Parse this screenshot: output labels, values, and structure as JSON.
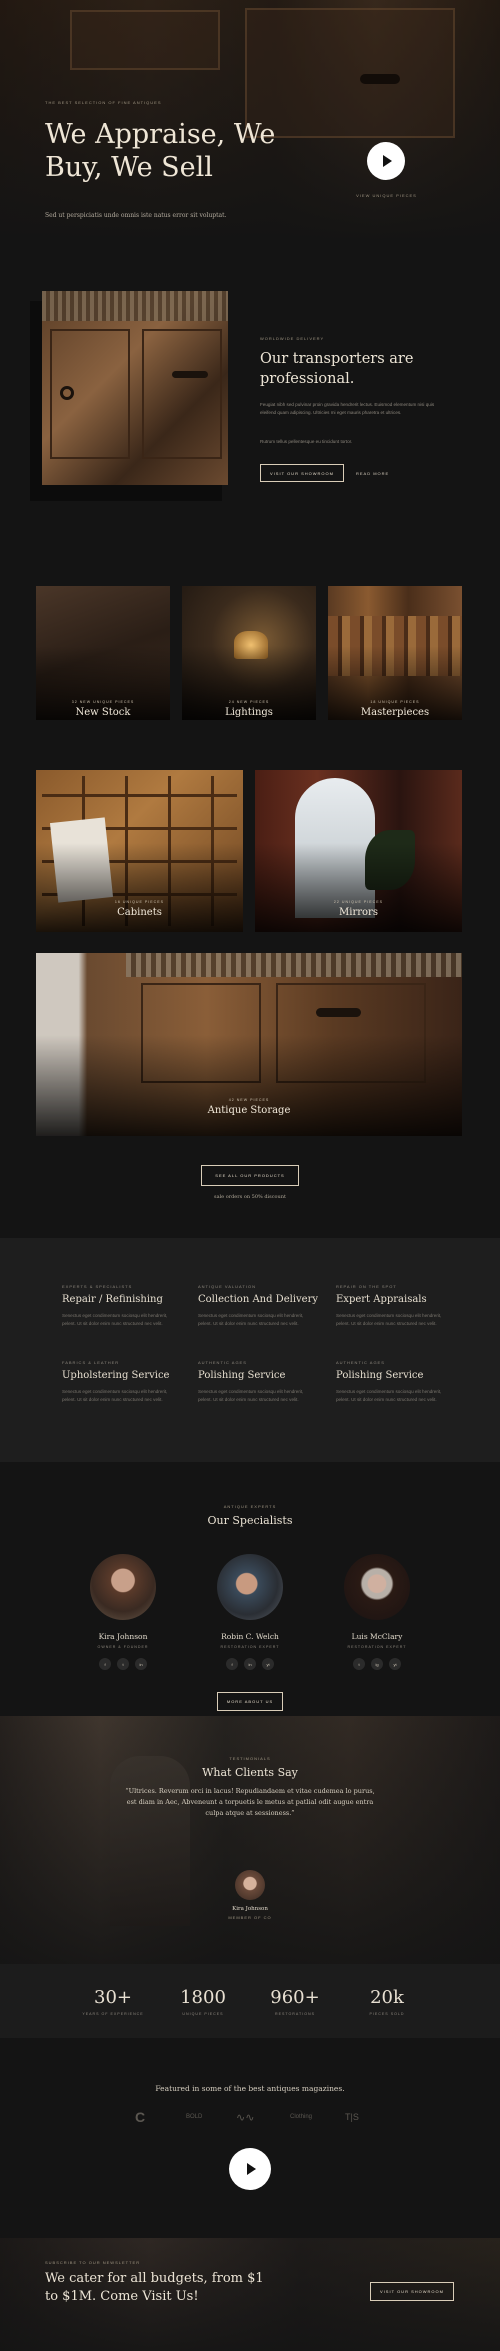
{
  "hero": {
    "eyebrow": "The best selection of fine antiques",
    "title": "We Appraise, We Buy, We Sell",
    "subtitle": "Sed ut perspiciatis unde omnis iste natus error sit voluptat.",
    "play_caption": "View unique pieces"
  },
  "transport": {
    "eyebrow": "Worldwide delivery",
    "title": "Our transporters are professional.",
    "text1": "Feugiat nibh sed pulvinar proin gravida hendrerit lectus. Euismod elementum nisi quis eleifend quam adipiscing. Ultricies mi eget mauris pharetra et ultrices.",
    "text2": "Rutrum tellus pellentesque eu tincidunt tortor.",
    "cta_primary": "Visit our showroom",
    "cta_secondary": "Read more"
  },
  "products": {
    "tiles": [
      {
        "category": "32 new unique pieces",
        "name": "New Stock"
      },
      {
        "category": "24 new pieces",
        "name": "Lightings"
      },
      {
        "category": "18 unique pieces",
        "name": "Masterpieces"
      },
      {
        "category": "16 unique pieces",
        "name": "Cabinets"
      },
      {
        "category": "22 unique pieces",
        "name": "Mirrors"
      },
      {
        "category": "42 new pieces",
        "name": "Antique Storage"
      }
    ],
    "cta": "See all our products",
    "note": "sale orders on 50% discount"
  },
  "services": [
    {
      "category": "Experts & Specialists",
      "title": "Repair / Refinishing",
      "text": "Senectus eget condimentum sociosqu elit hendrerit, pelent. Ut sit dolor enim nunc structured nec velit."
    },
    {
      "category": "Antique Valuation",
      "title": "Collection And Delivery",
      "text": "Senectus eget condimentum sociosqu elit hendrerit, pelent. Ut sit dolor enim nunc structured nec velit."
    },
    {
      "category": "Repair on the spot",
      "title": "Expert Appraisals",
      "text": "Senectus eget condimentum sociosqu elit hendrerit, pelent. Ut sit dolor enim nunc structured nec velit."
    },
    {
      "category": "Fabrics & Leather",
      "title": "Upholstering Service",
      "text": "Senectus eget condimentum sociosqu elit hendrerit, pelent. Ut sit dolor enim nunc structured nec velit."
    },
    {
      "category": "Authentic ages",
      "title": "Polishing Service",
      "text": "Senectus eget condimentum sociosqu elit hendrerit, pelent. Ut sit dolor enim nunc structured nec velit."
    },
    {
      "category": "Authentic ages",
      "title": "Polishing Service",
      "text": "Senectus eget condimentum sociosqu elit hendrerit, pelent. Ut sit dolor enim nunc structured nec velit."
    }
  ],
  "specialists": {
    "eyebrow": "Antique experts",
    "title": "Our Specialists",
    "people": [
      {
        "name": "Kira Johnson",
        "role": "Owner & Founder",
        "social": [
          "f",
          "t",
          "in"
        ]
      },
      {
        "name": "Robin C. Welch",
        "role": "Restoration expert",
        "social": [
          "f",
          "in",
          "yt"
        ]
      },
      {
        "name": "Luis McClary",
        "role": "Restoration expert",
        "social": [
          "t",
          "ig",
          "yt"
        ]
      }
    ],
    "cta": "More about us"
  },
  "testimonial": {
    "eyebrow": "Testimonials",
    "title": "What Clients Say",
    "quote": "“Ultrices. Reverum orci in lacus! Repudiandaem et vitae cudemea lo purus, est diam in Aec, Abveneunt a torpuetis le metus at patlial odit augue entra culpa atque at sessioness.”",
    "name": "Kira Johnson",
    "role": "Member of CO"
  },
  "stats": [
    {
      "value": "30+",
      "label": "Years of experience"
    },
    {
      "value": "1800",
      "label": "Unique pieces"
    },
    {
      "value": "960+",
      "label": "Restorations"
    },
    {
      "value": "20k",
      "label": "Pieces sold"
    }
  ],
  "featured": {
    "title": "Featured in some of the best antiques magazines.",
    "logos": [
      "C",
      "BOLD",
      "∿∿",
      "Clothing",
      "T|S"
    ]
  },
  "footer_cta": {
    "eyebrow": "Subscribe to our newsletter",
    "title": "We cater for all budgets, from $1 to $1M. Come Visit Us!",
    "button": "Visit our showroom"
  }
}
